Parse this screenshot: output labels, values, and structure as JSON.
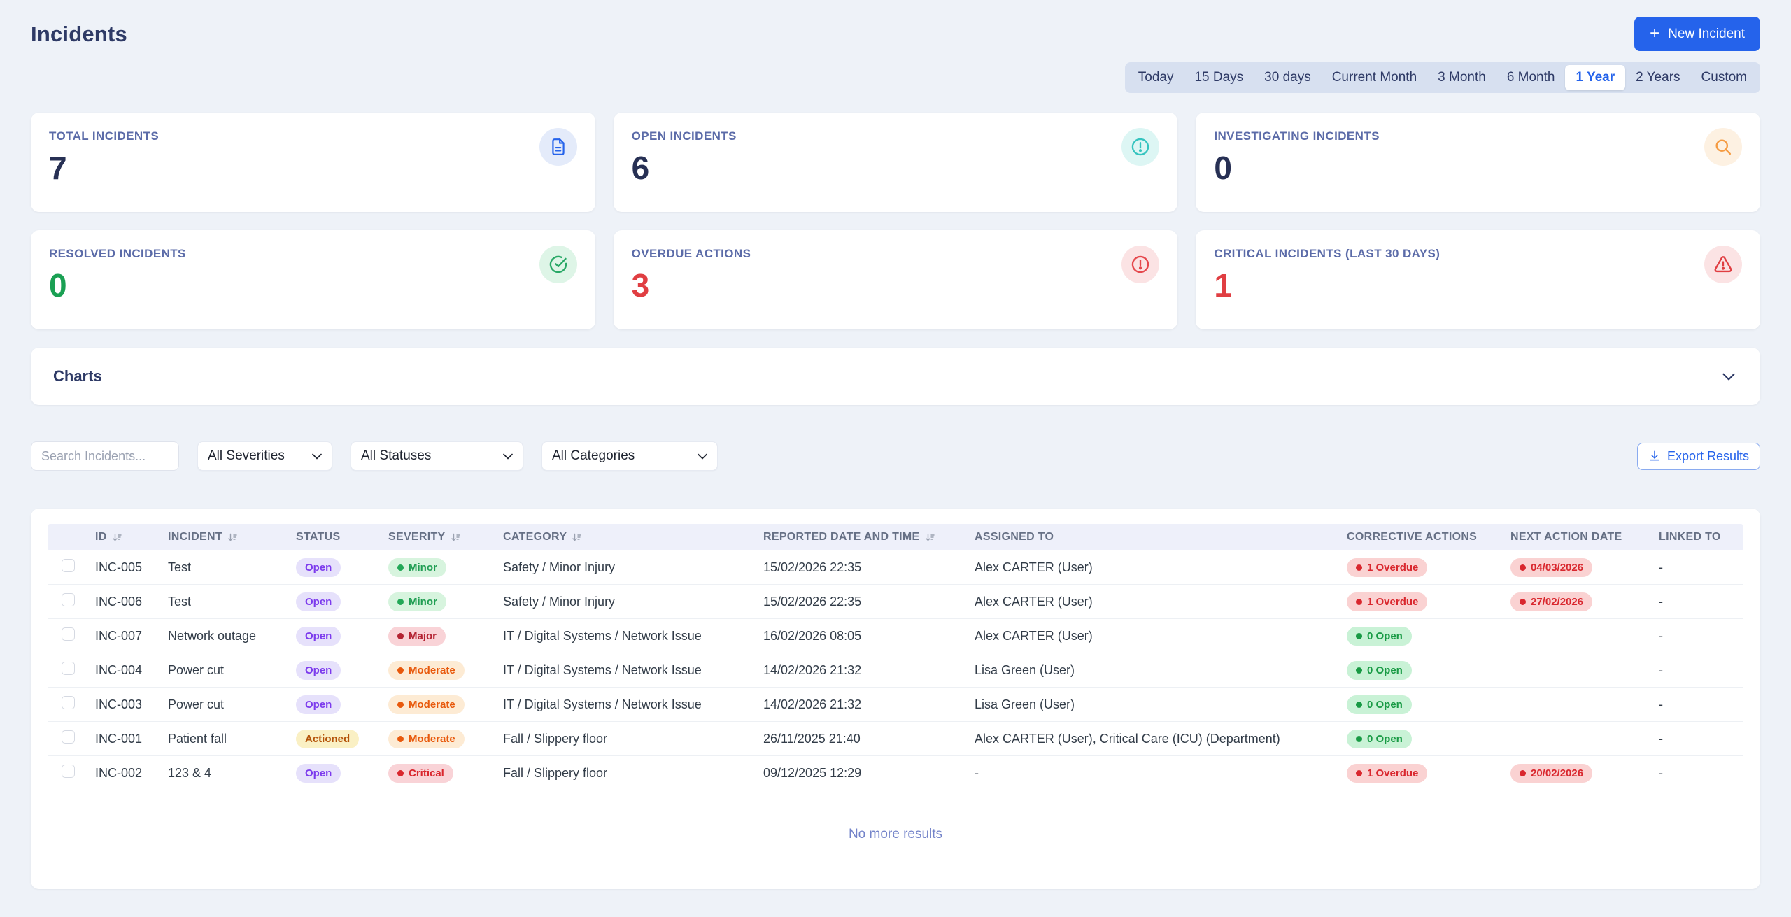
{
  "page": {
    "title": "Incidents"
  },
  "header": {
    "new_incident_label": "New Incident"
  },
  "time_filters": {
    "options": [
      "Today",
      "15 Days",
      "30 days",
      "Current Month",
      "3 Month",
      "6 Month",
      "1 Year",
      "2 Years",
      "Custom"
    ],
    "active": "1 Year"
  },
  "stat_cards": [
    {
      "label": "TOTAL INCIDENTS",
      "value": "7",
      "icon": "document-icon"
    },
    {
      "label": "OPEN INCIDENTS",
      "value": "6",
      "icon": "alert-circle-icon"
    },
    {
      "label": "INVESTIGATING INCIDENTS",
      "value": "0",
      "icon": "search-icon"
    },
    {
      "label": "RESOLVED INCIDENTS",
      "value": "0",
      "icon": "check-circle-icon"
    },
    {
      "label": "OVERDUE ACTIONS",
      "value": "3",
      "icon": "alert-circle-icon"
    },
    {
      "label": "CRITICAL INCIDENTS (LAST 30 DAYS)",
      "value": "1",
      "icon": "warning-triangle-icon"
    }
  ],
  "charts_section": {
    "title": "Charts"
  },
  "filters": {
    "search_placeholder": "Search Incidents...",
    "severity_value": "All Severities",
    "status_value": "All Statuses",
    "category_value": "All Categories",
    "export_label": "Export Results"
  },
  "table": {
    "columns": [
      {
        "label": "ID",
        "sortable": true
      },
      {
        "label": "INCIDENT",
        "sortable": true
      },
      {
        "label": "STATUS",
        "sortable": false
      },
      {
        "label": "SEVERITY",
        "sortable": true
      },
      {
        "label": "CATEGORY",
        "sortable": true
      },
      {
        "label": "REPORTED DATE AND TIME",
        "sortable": true
      },
      {
        "label": "ASSIGNED TO",
        "sortable": false
      },
      {
        "label": "CORRECTIVE ACTIONS",
        "sortable": false
      },
      {
        "label": "NEXT ACTION DATE",
        "sortable": false
      },
      {
        "label": "LINKED TO",
        "sortable": false
      }
    ],
    "rows": [
      {
        "id": "INC-005",
        "incident": "Test",
        "status": "Open",
        "severity": "Minor",
        "category": "Safety / Minor Injury",
        "reported": "15/02/2026 22:35",
        "assigned": "Alex CARTER (User)",
        "corrective": "1 Overdue",
        "next_action": "04/03/2026",
        "linked": "-"
      },
      {
        "id": "INC-006",
        "incident": "Test",
        "status": "Open",
        "severity": "Minor",
        "category": "Safety / Minor Injury",
        "reported": "15/02/2026 22:35",
        "assigned": "Alex CARTER (User)",
        "corrective": "1 Overdue",
        "next_action": "27/02/2026",
        "linked": "-"
      },
      {
        "id": "INC-007",
        "incident": "Network outage",
        "status": "Open",
        "severity": "Major",
        "category": "IT / Digital Systems / Network Issue",
        "reported": "16/02/2026 08:05",
        "assigned": "Alex CARTER (User)",
        "corrective": "0 Open",
        "next_action": "",
        "linked": "-"
      },
      {
        "id": "INC-004",
        "incident": "Power cut",
        "status": "Open",
        "severity": "Moderate",
        "category": "IT / Digital Systems / Network Issue",
        "reported": "14/02/2026 21:32",
        "assigned": "Lisa Green (User)",
        "corrective": "0 Open",
        "next_action": "",
        "linked": "-"
      },
      {
        "id": "INC-003",
        "incident": "Power cut",
        "status": "Open",
        "severity": "Moderate",
        "category": "IT / Digital Systems / Network Issue",
        "reported": "14/02/2026 21:32",
        "assigned": "Lisa Green (User)",
        "corrective": "0 Open",
        "next_action": "",
        "linked": "-"
      },
      {
        "id": "INC-001",
        "incident": "Patient fall",
        "status": "Actioned",
        "severity": "Moderate",
        "category": "Fall / Slippery floor",
        "reported": "26/11/2025 21:40",
        "assigned": "Alex CARTER (User), Critical Care (ICU) (Department)",
        "corrective": "0 Open",
        "next_action": "",
        "linked": "-"
      },
      {
        "id": "INC-002",
        "incident": "123 & 4",
        "status": "Open",
        "severity": "Critical",
        "category": "Fall / Slippery floor",
        "reported": "09/12/2025 12:29",
        "assigned": "-",
        "corrective": "1 Overdue",
        "next_action": "20/02/2026",
        "linked": "-"
      }
    ],
    "footer": "No more results"
  },
  "colors": {
    "accent_blue": "#2563eb",
    "navy_text": "#2e3a66",
    "green": "#1aa053",
    "red": "#e03e42",
    "teal": "#35c4bf",
    "orange": "#f59b42",
    "status_open_text": "#7c3aed",
    "status_actioned_text": "#b45309"
  }
}
